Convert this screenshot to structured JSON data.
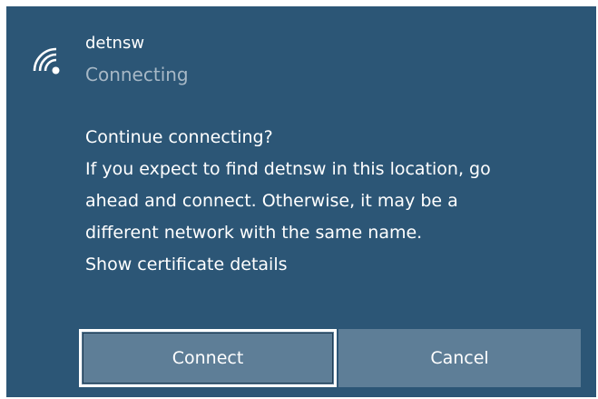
{
  "network": {
    "name": "detnsw",
    "status": "Connecting",
    "icon": "wifi-signal-icon"
  },
  "prompt": {
    "lines": [
      "Continue connecting?",
      "If you expect to find detnsw in this location, go",
      "ahead and connect. Otherwise, it may be a",
      "different network with the same name."
    ],
    "certificate_link": "Show certificate details"
  },
  "buttons": {
    "connect_label": "Connect",
    "cancel_label": "Cancel"
  },
  "colors": {
    "panel_background": "#2c5676",
    "button_background": "#5e7e97",
    "status_text": "#a7b8c6",
    "focus_border": "#ffffff"
  }
}
